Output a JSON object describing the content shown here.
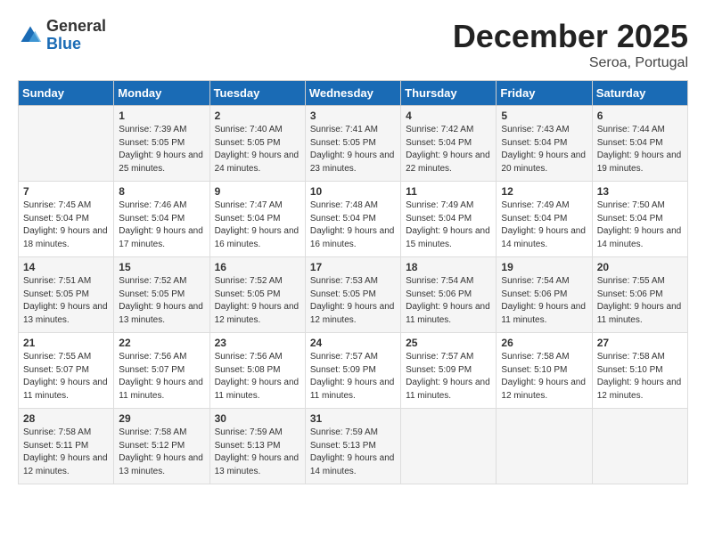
{
  "header": {
    "logo_general": "General",
    "logo_blue": "Blue",
    "month_title": "December 2025",
    "location": "Seroa, Portugal"
  },
  "calendar": {
    "days_of_week": [
      "Sunday",
      "Monday",
      "Tuesday",
      "Wednesday",
      "Thursday",
      "Friday",
      "Saturday"
    ],
    "weeks": [
      [
        {
          "day": "",
          "sunrise": "",
          "sunset": "",
          "daylight": ""
        },
        {
          "day": "1",
          "sunrise": "7:39 AM",
          "sunset": "5:05 PM",
          "daylight": "9 hours and 25 minutes."
        },
        {
          "day": "2",
          "sunrise": "7:40 AM",
          "sunset": "5:05 PM",
          "daylight": "9 hours and 24 minutes."
        },
        {
          "day": "3",
          "sunrise": "7:41 AM",
          "sunset": "5:05 PM",
          "daylight": "9 hours and 23 minutes."
        },
        {
          "day": "4",
          "sunrise": "7:42 AM",
          "sunset": "5:04 PM",
          "daylight": "9 hours and 22 minutes."
        },
        {
          "day": "5",
          "sunrise": "7:43 AM",
          "sunset": "5:04 PM",
          "daylight": "9 hours and 20 minutes."
        },
        {
          "day": "6",
          "sunrise": "7:44 AM",
          "sunset": "5:04 PM",
          "daylight": "9 hours and 19 minutes."
        }
      ],
      [
        {
          "day": "7",
          "sunrise": "7:45 AM",
          "sunset": "5:04 PM",
          "daylight": "9 hours and 18 minutes."
        },
        {
          "day": "8",
          "sunrise": "7:46 AM",
          "sunset": "5:04 PM",
          "daylight": "9 hours and 17 minutes."
        },
        {
          "day": "9",
          "sunrise": "7:47 AM",
          "sunset": "5:04 PM",
          "daylight": "9 hours and 16 minutes."
        },
        {
          "day": "10",
          "sunrise": "7:48 AM",
          "sunset": "5:04 PM",
          "daylight": "9 hours and 16 minutes."
        },
        {
          "day": "11",
          "sunrise": "7:49 AM",
          "sunset": "5:04 PM",
          "daylight": "9 hours and 15 minutes."
        },
        {
          "day": "12",
          "sunrise": "7:49 AM",
          "sunset": "5:04 PM",
          "daylight": "9 hours and 14 minutes."
        },
        {
          "day": "13",
          "sunrise": "7:50 AM",
          "sunset": "5:04 PM",
          "daylight": "9 hours and 14 minutes."
        }
      ],
      [
        {
          "day": "14",
          "sunrise": "7:51 AM",
          "sunset": "5:05 PM",
          "daylight": "9 hours and 13 minutes."
        },
        {
          "day": "15",
          "sunrise": "7:52 AM",
          "sunset": "5:05 PM",
          "daylight": "9 hours and 13 minutes."
        },
        {
          "day": "16",
          "sunrise": "7:52 AM",
          "sunset": "5:05 PM",
          "daylight": "9 hours and 12 minutes."
        },
        {
          "day": "17",
          "sunrise": "7:53 AM",
          "sunset": "5:05 PM",
          "daylight": "9 hours and 12 minutes."
        },
        {
          "day": "18",
          "sunrise": "7:54 AM",
          "sunset": "5:06 PM",
          "daylight": "9 hours and 11 minutes."
        },
        {
          "day": "19",
          "sunrise": "7:54 AM",
          "sunset": "5:06 PM",
          "daylight": "9 hours and 11 minutes."
        },
        {
          "day": "20",
          "sunrise": "7:55 AM",
          "sunset": "5:06 PM",
          "daylight": "9 hours and 11 minutes."
        }
      ],
      [
        {
          "day": "21",
          "sunrise": "7:55 AM",
          "sunset": "5:07 PM",
          "daylight": "9 hours and 11 minutes."
        },
        {
          "day": "22",
          "sunrise": "7:56 AM",
          "sunset": "5:07 PM",
          "daylight": "9 hours and 11 minutes."
        },
        {
          "day": "23",
          "sunrise": "7:56 AM",
          "sunset": "5:08 PM",
          "daylight": "9 hours and 11 minutes."
        },
        {
          "day": "24",
          "sunrise": "7:57 AM",
          "sunset": "5:09 PM",
          "daylight": "9 hours and 11 minutes."
        },
        {
          "day": "25",
          "sunrise": "7:57 AM",
          "sunset": "5:09 PM",
          "daylight": "9 hours and 11 minutes."
        },
        {
          "day": "26",
          "sunrise": "7:58 AM",
          "sunset": "5:10 PM",
          "daylight": "9 hours and 12 minutes."
        },
        {
          "day": "27",
          "sunrise": "7:58 AM",
          "sunset": "5:10 PM",
          "daylight": "9 hours and 12 minutes."
        }
      ],
      [
        {
          "day": "28",
          "sunrise": "7:58 AM",
          "sunset": "5:11 PM",
          "daylight": "9 hours and 12 minutes."
        },
        {
          "day": "29",
          "sunrise": "7:58 AM",
          "sunset": "5:12 PM",
          "daylight": "9 hours and 13 minutes."
        },
        {
          "day": "30",
          "sunrise": "7:59 AM",
          "sunset": "5:13 PM",
          "daylight": "9 hours and 13 minutes."
        },
        {
          "day": "31",
          "sunrise": "7:59 AM",
          "sunset": "5:13 PM",
          "daylight": "9 hours and 14 minutes."
        },
        {
          "day": "",
          "sunrise": "",
          "sunset": "",
          "daylight": ""
        },
        {
          "day": "",
          "sunrise": "",
          "sunset": "",
          "daylight": ""
        },
        {
          "day": "",
          "sunrise": "",
          "sunset": "",
          "daylight": ""
        }
      ]
    ]
  }
}
